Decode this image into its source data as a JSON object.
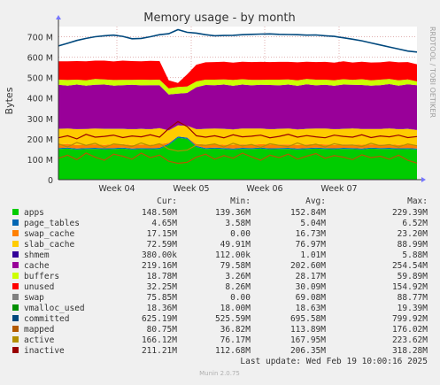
{
  "side_text": "RRDTOOL / TOBI OETIKER",
  "footer": {
    "last_update": "Last update: Wed Feb 19 10:00:16 2025",
    "version": "Munin 2.0.75"
  },
  "legend": {
    "headers": [
      "Cur:",
      "Min:",
      "Avg:",
      "Max:"
    ],
    "rows": [
      {
        "name": "apps",
        "color": "#00cc00",
        "cur": "148.50M",
        "min": "139.36M",
        "avg": "152.84M",
        "max": "229.39M"
      },
      {
        "name": "page_tables",
        "color": "#0066b3",
        "cur": "4.65M",
        "min": "3.58M",
        "avg": "5.04M",
        "max": "6.52M"
      },
      {
        "name": "swap_cache",
        "color": "#ff8000",
        "cur": "17.15M",
        "min": "0.00",
        "avg": "16.73M",
        "max": "23.20M"
      },
      {
        "name": "slab_cache",
        "color": "#ffcc00",
        "cur": "72.59M",
        "min": "49.91M",
        "avg": "76.97M",
        "max": "88.99M"
      },
      {
        "name": "shmem",
        "color": "#330099",
        "cur": "380.00k",
        "min": "112.00k",
        "avg": "1.01M",
        "max": "5.88M"
      },
      {
        "name": "cache",
        "color": "#990099",
        "cur": "219.16M",
        "min": "79.58M",
        "avg": "202.60M",
        "max": "254.54M"
      },
      {
        "name": "buffers",
        "color": "#ccff00",
        "cur": "18.78M",
        "min": "3.26M",
        "avg": "28.17M",
        "max": "59.89M"
      },
      {
        "name": "unused",
        "color": "#ff0000",
        "cur": "32.25M",
        "min": "8.26M",
        "avg": "30.09M",
        "max": "154.92M"
      },
      {
        "name": "swap",
        "color": "#808080",
        "cur": "75.85M",
        "min": "0.00",
        "avg": "69.08M",
        "max": "88.77M"
      },
      {
        "name": "vmalloc_used",
        "color": "#008f00",
        "cur": "18.36M",
        "min": "18.00M",
        "avg": "18.63M",
        "max": "19.39M"
      },
      {
        "name": "committed",
        "color": "#00487d",
        "cur": "625.19M",
        "min": "525.59M",
        "avg": "695.58M",
        "max": "799.92M"
      },
      {
        "name": "mapped",
        "color": "#b35a00",
        "cur": "80.75M",
        "min": "36.82M",
        "avg": "113.89M",
        "max": "176.02M"
      },
      {
        "name": "active",
        "color": "#b38f00",
        "cur": "166.12M",
        "min": "76.17M",
        "avg": "167.95M",
        "max": "223.62M"
      },
      {
        "name": "inactive",
        "color": "#990000",
        "cur": "211.21M",
        "min": "112.68M",
        "avg": "206.35M",
        "max": "318.28M"
      }
    ]
  },
  "chart_data": {
    "type": "area",
    "title": "Memory usage - by month",
    "ylabel": "Bytes",
    "xlabel": "",
    "ylim": [
      0,
      750
    ],
    "yunit": "M",
    "y_ticks": [
      0,
      100,
      200,
      300,
      400,
      500,
      600,
      700
    ],
    "y_tick_labels": [
      "0",
      "100 M",
      "200 M",
      "300 M",
      "400 M",
      "500 M",
      "600 M",
      "700 M"
    ],
    "x_ticks": [
      "Week 04",
      "Week 05",
      "Week 06",
      "Week 07"
    ],
    "grid": true,
    "stacked_areas": [
      {
        "name": "apps",
        "values": [
          150,
          152,
          148,
          150,
          151,
          149,
          150,
          152,
          148,
          150,
          149,
          151,
          170,
          205,
          200,
          160,
          150,
          152,
          150,
          148,
          151,
          150,
          152,
          149,
          150,
          151,
          148,
          150,
          152,
          150,
          149,
          151,
          150,
          148,
          152,
          150,
          151,
          149,
          150,
          148
        ]
      },
      {
        "name": "page_tables",
        "values": [
          5,
          5,
          5,
          5,
          5,
          5,
          5,
          5,
          5,
          5,
          5,
          5,
          6,
          6,
          6,
          5,
          5,
          5,
          5,
          5,
          5,
          5,
          5,
          5,
          5,
          5,
          5,
          5,
          5,
          5,
          5,
          5,
          5,
          5,
          5,
          5,
          5,
          5,
          5,
          5
        ]
      },
      {
        "name": "swap_cache",
        "values": [
          17,
          18,
          16,
          17,
          17,
          16,
          18,
          17,
          16,
          17,
          17,
          18,
          5,
          0,
          0,
          10,
          17,
          17,
          16,
          18,
          17,
          16,
          17,
          18,
          17,
          16,
          17,
          17,
          18,
          17,
          16,
          17,
          17,
          18,
          16,
          17,
          17,
          16,
          18,
          17
        ]
      },
      {
        "name": "slab_cache",
        "values": [
          77,
          75,
          78,
          76,
          77,
          79,
          76,
          75,
          78,
          77,
          76,
          78,
          60,
          55,
          58,
          72,
          77,
          76,
          78,
          75,
          77,
          79,
          76,
          75,
          77,
          78,
          76,
          77,
          75,
          78,
          77,
          76,
          79,
          77,
          75,
          76,
          78,
          77,
          76,
          73
        ]
      },
      {
        "name": "shmem",
        "values": [
          1,
          1,
          1,
          1,
          1,
          1,
          1,
          1,
          1,
          1,
          1,
          1,
          1,
          1,
          1,
          1,
          1,
          1,
          1,
          1,
          1,
          1,
          1,
          1,
          1,
          1,
          1,
          1,
          1,
          1,
          1,
          1,
          1,
          1,
          1,
          1,
          1,
          1,
          1,
          0.4
        ]
      },
      {
        "name": "cache",
        "values": [
          215,
          210,
          218,
          212,
          214,
          216,
          211,
          213,
          217,
          212,
          215,
          210,
          175,
          155,
          160,
          205,
          214,
          212,
          216,
          213,
          215,
          211,
          214,
          216,
          212,
          215,
          213,
          217,
          211,
          214,
          212,
          216,
          213,
          215,
          212,
          214,
          216,
          213,
          217,
          219
        ]
      },
      {
        "name": "buffers",
        "values": [
          25,
          27,
          24,
          26,
          28,
          25,
          27,
          26,
          24,
          28,
          26,
          27,
          30,
          32,
          31,
          28,
          26,
          27,
          25,
          28,
          26,
          27,
          24,
          26,
          28,
          25,
          27,
          26,
          28,
          25,
          27,
          26,
          24,
          28,
          26,
          27,
          25,
          26,
          24,
          19
        ]
      },
      {
        "name": "unused",
        "values": [
          90,
          92,
          91,
          93,
          90,
          92,
          91,
          94,
          92,
          90,
          93,
          91,
          40,
          20,
          60,
          82,
          85,
          86,
          87,
          85,
          86,
          87,
          88,
          86,
          87,
          86,
          88,
          85,
          86,
          87,
          86,
          88,
          85,
          86,
          87,
          85,
          86,
          88,
          85,
          84
        ]
      }
    ],
    "lines": [
      {
        "name": "committed",
        "values": [
          655,
          668,
          682,
          692,
          700,
          705,
          708,
          702,
          690,
          692,
          700,
          710,
          715,
          735,
          722,
          718,
          710,
          705,
          706,
          707,
          710,
          712,
          713,
          714,
          712,
          711,
          710,
          708,
          709,
          705,
          702,
          695,
          688,
          680,
          670,
          660,
          650,
          640,
          630,
          625
        ]
      },
      {
        "name": "mapped",
        "values": [
          105,
          120,
          98,
          130,
          110,
          95,
          125,
          115,
          100,
          130,
          108,
          120,
          90,
          80,
          85,
          110,
          125,
          100,
          118,
          105,
          130,
          112,
          95,
          120,
          108,
          125,
          100,
          115,
          128,
          105,
          118,
          110,
          98,
          122,
          108,
          115,
          100,
          120,
          95,
          81
        ]
      },
      {
        "name": "active",
        "values": [
          175,
          160,
          182,
          168,
          178,
          158,
          175,
          170,
          162,
          180,
          165,
          176,
          150,
          140,
          145,
          170,
          168,
          175,
          160,
          178,
          165,
          172,
          158,
          176,
          168,
          162,
          180,
          165,
          174,
          160,
          176,
          168,
          170,
          162,
          178,
          166,
          172,
          160,
          175,
          166
        ]
      },
      {
        "name": "inactive",
        "values": [
          205,
          215,
          200,
          222,
          208,
          212,
          218,
          206,
          214,
          210,
          220,
          208,
          250,
          285,
          260,
          215,
          208,
          215,
          205,
          220,
          210,
          213,
          218,
          205,
          212,
          222,
          208,
          216,
          210,
          205,
          218,
          212,
          208,
          220,
          206,
          214,
          210,
          218,
          206,
          211
        ]
      }
    ]
  }
}
